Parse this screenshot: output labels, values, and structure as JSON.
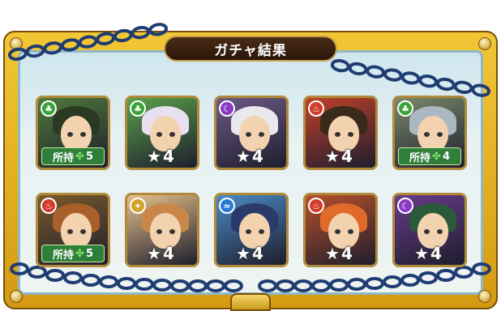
{
  "title": "ガチャ結果",
  "star_glyph": "★",
  "clover_glyph": "✤",
  "cards": [
    {
      "row": 0,
      "col": 0,
      "name": "card-1",
      "attr": "wood",
      "attr_color": "#3aa23a",
      "bg": "#4f7a3a",
      "hair": "#2a3a22",
      "badge": "owned",
      "owned_label": "所持",
      "owned_count": "5"
    },
    {
      "row": 0,
      "col": 1,
      "name": "card-2",
      "attr": "wood",
      "attr_color": "#3aa23a",
      "bg": "#5aa04a",
      "hair": "#e8e0f0",
      "badge": "stars",
      "stars": "4"
    },
    {
      "row": 0,
      "col": 2,
      "name": "card-3",
      "attr": "dark",
      "attr_color": "#8a3ac2",
      "bg": "#6c5a86",
      "hair": "#e8e8ee",
      "badge": "stars",
      "stars": "4"
    },
    {
      "row": 0,
      "col": 3,
      "name": "card-4",
      "attr": "fire",
      "attr_color": "#d23a2a",
      "bg": "#c0402a",
      "hair": "#3a2a1a",
      "badge": "stars",
      "stars": "4"
    },
    {
      "row": 0,
      "col": 4,
      "name": "card-5",
      "attr": "wood",
      "attr_color": "#3aa23a",
      "bg": "#7a8a6a",
      "hair": "#aab8c2",
      "badge": "owned",
      "owned_label": "所持",
      "owned_count": "4"
    },
    {
      "row": 1,
      "col": 0,
      "name": "card-6",
      "attr": "fire",
      "attr_color": "#d23a2a",
      "bg": "#7a5a2a",
      "hair": "#a8602a",
      "badge": "owned",
      "owned_label": "所持",
      "owned_count": "5"
    },
    {
      "row": 1,
      "col": 1,
      "name": "card-7",
      "attr": "light",
      "attr_color": "#d2a22a",
      "bg": "#e6c08a",
      "hair": "#c9884a",
      "badge": "stars",
      "stars": "4"
    },
    {
      "row": 1,
      "col": 2,
      "name": "card-8",
      "attr": "water",
      "attr_color": "#2a7ad2",
      "bg": "#4a8ac2",
      "hair": "#2a3a6a",
      "badge": "stars",
      "stars": "4"
    },
    {
      "row": 1,
      "col": 3,
      "name": "card-9",
      "attr": "fire",
      "attr_color": "#d23a2a",
      "bg": "#b8502a",
      "hair": "#e06a2a",
      "badge": "stars",
      "stars": "4"
    },
    {
      "row": 1,
      "col": 4,
      "name": "card-10",
      "attr": "dark",
      "attr_color": "#8a3ac2",
      "bg": "#6a3a8a",
      "hair": "#2a5a3a",
      "badge": "stars",
      "stars": "4"
    }
  ]
}
